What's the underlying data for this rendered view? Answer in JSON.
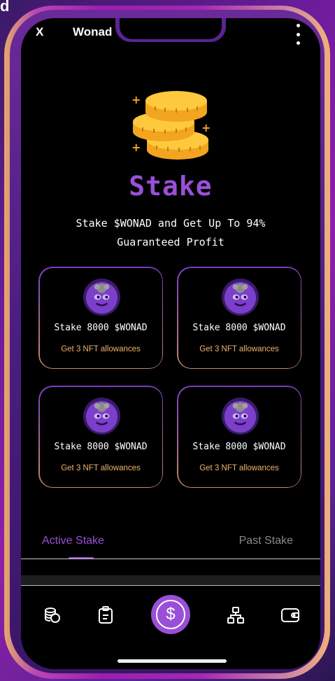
{
  "corner": {
    "label": "d"
  },
  "header": {
    "close_label": "X",
    "title": "Wonad"
  },
  "hero": {
    "title": "Stake",
    "subtitle": "Stake $WONAD and Get Up To 94% Guaranteed Profit"
  },
  "cards": [
    {
      "label": "Stake 8000 $WONAD",
      "note": "Get 3 NFT allowances"
    },
    {
      "label": "Stake 8000 $WONAD",
      "note": "Get 3 NFT allowances"
    },
    {
      "label": "Stake 8000 $WONAD",
      "note": "Get 3 NFT allowances"
    },
    {
      "label": "Stake 8000 $WONAD",
      "note": "Get 3 NFT allowances"
    }
  ],
  "tabs": {
    "active": "Active Stake",
    "inactive": "Past Stake"
  },
  "nav": {
    "items": [
      "coins-icon",
      "clipboard-icon",
      "dollar-icon",
      "sitemap-icon",
      "wallet-icon"
    ],
    "center_glyph": "$"
  },
  "colors": {
    "accent": "#9a4fd8",
    "note": "#f0b36a",
    "background": "#000000"
  }
}
